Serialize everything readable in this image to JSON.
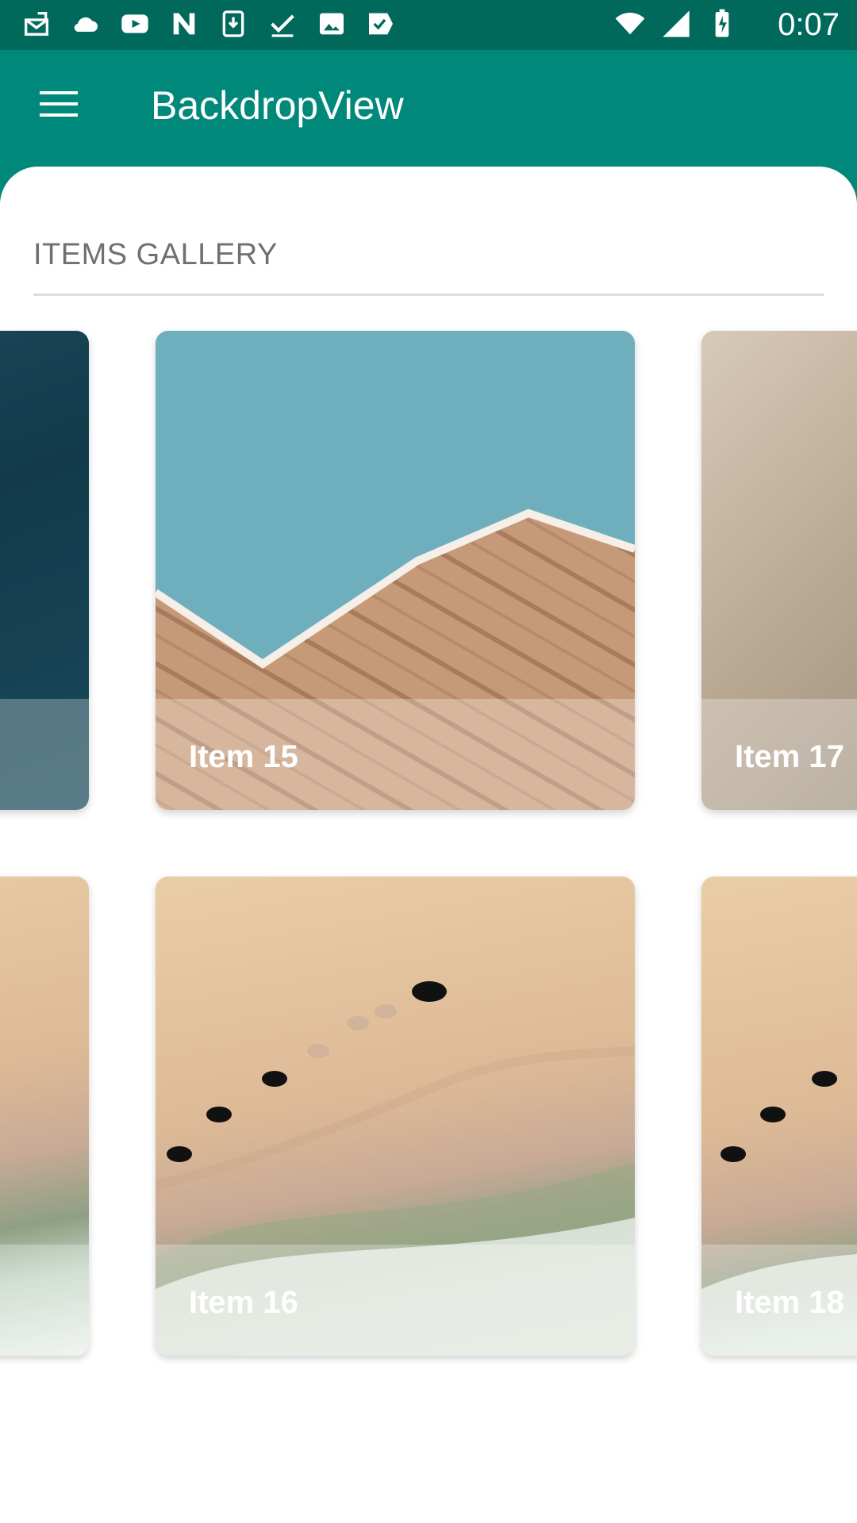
{
  "status_bar": {
    "time": "0:07",
    "left_icons": [
      "inbox-icon",
      "cloud-icon",
      "youtube-icon",
      "n-icon",
      "download-icon",
      "check-icon",
      "image-icon",
      "label-check-icon"
    ],
    "right_icons": [
      "wifi-icon",
      "signal-icon",
      "battery-charging-icon"
    ]
  },
  "app_bar": {
    "title": "BackdropView",
    "menu_icon": "hamburger-menu-icon"
  },
  "gallery": {
    "section_title": "ITEMS GALLERY",
    "rows": [
      {
        "items": [
          {
            "label": ""
          },
          {
            "label": "Item 15"
          },
          {
            "label": "Item 17"
          }
        ]
      },
      {
        "items": [
          {
            "label": ""
          },
          {
            "label": "Item 16"
          },
          {
            "label": "Item 18"
          }
        ]
      }
    ]
  },
  "colors": {
    "status_bar": "#00695c",
    "app_bar": "#00897b",
    "sheet": "#ffffff",
    "section_title": "#707070",
    "divider": "#dddddd"
  }
}
